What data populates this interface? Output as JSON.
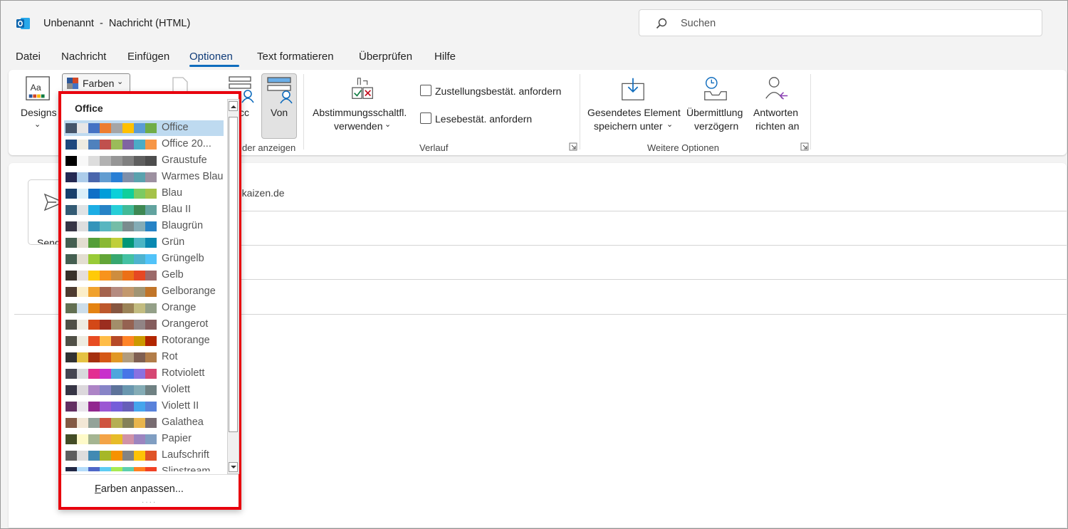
{
  "window": {
    "title": "Unbenannt  -  Nachricht (HTML)",
    "app_icon": "outlook-icon"
  },
  "search": {
    "placeholder": "Suchen"
  },
  "menu": {
    "tabs": [
      "Datei",
      "Nachricht",
      "Einfügen",
      "Optionen",
      "Text formatieren",
      "Überprüfen",
      "Hilfe"
    ],
    "active": "Optionen"
  },
  "ribbon": {
    "designs": "Designs",
    "farben": "Farben",
    "cc": "cc",
    "von": "Von",
    "felder_anzeigen": "der anzeigen",
    "abstimmung_line1": "Abstimmungsschaltfl.",
    "abstimmung_line2": "verwenden",
    "zustellung": "Zustellungsbestät. anfordern",
    "lesebest": "Lesebestät. anfordern",
    "verlauf": "Verlauf",
    "gesendet_line1": "Gesendetes Element",
    "gesendet_line2": "speichern unter",
    "uebermittlung_line1": "Übermittlung",
    "uebermittlung_line2": "verzögern",
    "antworten_line1": "Antworten",
    "antworten_line2": "richten an",
    "weitere": "Weitere Optionen"
  },
  "mail": {
    "send": "Send",
    "from_partial": "-kaizen.de"
  },
  "dropdown": {
    "header": "Office",
    "footer_prefix": "F",
    "footer_rest": "arben anpassen...",
    "selected": "Office",
    "schemes": [
      {
        "name": "Office",
        "colors": [
          "#44546a",
          "#e7e6e6",
          "#4472c4",
          "#ed7d31",
          "#a5a5a5",
          "#ffc000",
          "#5b9bd5",
          "#70ad47"
        ]
      },
      {
        "name": "Office 20...",
        "colors": [
          "#1f497d",
          "#eeece1",
          "#4f81bd",
          "#c0504d",
          "#9bbb59",
          "#8064a2",
          "#4bacc6",
          "#f79646"
        ]
      },
      {
        "name": "Graustufe",
        "colors": [
          "#000000",
          "#f8f8f8",
          "#dddddd",
          "#b2b2b2",
          "#969696",
          "#808080",
          "#5f5f5f",
          "#4d4d4d"
        ]
      },
      {
        "name": "Warmes Blau",
        "colors": [
          "#242852",
          "#acccea",
          "#4a66ac",
          "#629dd1",
          "#297fd5",
          "#7f8fa9",
          "#5aa2ae",
          "#9d90a0"
        ]
      },
      {
        "name": "Blau",
        "colors": [
          "#17406d",
          "#dbeff9",
          "#0f6fc6",
          "#009dd9",
          "#0bd0d9",
          "#10cf9b",
          "#7cca62",
          "#a5c249"
        ]
      },
      {
        "name": "Blau II",
        "colors": [
          "#335b74",
          "#dfe3e5",
          "#1cade4",
          "#2683c6",
          "#27ced7",
          "#42ba97",
          "#3e8853",
          "#62a39f"
        ]
      },
      {
        "name": "Blaugrün",
        "colors": [
          "#373545",
          "#dedede",
          "#3494ba",
          "#58b6c0",
          "#75bda7",
          "#7a8c8e",
          "#84acb6",
          "#2683c6"
        ]
      },
      {
        "name": "Grün",
        "colors": [
          "#455f51",
          "#e3ded1",
          "#549e39",
          "#8ab833",
          "#c0cf3a",
          "#029676",
          "#4ab5c4",
          "#0989b1"
        ]
      },
      {
        "name": "Grüngelb",
        "colors": [
          "#455f51",
          "#e3ded1",
          "#99cb38",
          "#63a537",
          "#37a76f",
          "#44c1a3",
          "#4eb3cf",
          "#51c3f9"
        ]
      },
      {
        "name": "Gelb",
        "colors": [
          "#39302a",
          "#e5dedb",
          "#ffca08",
          "#f8931d",
          "#ce8d3e",
          "#ec7016",
          "#e64823",
          "#9c6a6a"
        ]
      },
      {
        "name": "Gelborange",
        "colors": [
          "#4e3b30",
          "#fbeec9",
          "#f0a22e",
          "#a5644e",
          "#b58b80",
          "#c3986d",
          "#a19574",
          "#c17529"
        ]
      },
      {
        "name": "Orange",
        "colors": [
          "#637052",
          "#ccddea",
          "#e48312",
          "#bd582c",
          "#865640",
          "#9b8357",
          "#c2bc80",
          "#94a088"
        ]
      },
      {
        "name": "Orangerot",
        "colors": [
          "#505046",
          "#eeece1",
          "#d34817",
          "#9b2d1f",
          "#a28e6a",
          "#956251",
          "#918485",
          "#855d5d"
        ]
      },
      {
        "name": "Rotorange",
        "colors": [
          "#505046",
          "#eeece1",
          "#e84c22",
          "#ffbd47",
          "#b64926",
          "#ff8427",
          "#cc9900",
          "#b22600"
        ]
      },
      {
        "name": "Rot",
        "colors": [
          "#323232",
          "#e5c243",
          "#a5300f",
          "#d55816",
          "#e19825",
          "#b19c7d",
          "#7f5f52",
          "#b27d49"
        ]
      },
      {
        "name": "Rotviolett",
        "colors": [
          "#454551",
          "#d8d9dc",
          "#e32d91",
          "#c830cc",
          "#4ea6dc",
          "#4775e7",
          "#8971e1",
          "#d54773"
        ]
      },
      {
        "name": "Violett",
        "colors": [
          "#373545",
          "#dcd8dc",
          "#ad84c6",
          "#8784c7",
          "#5d739a",
          "#6997af",
          "#84acb6",
          "#6f8183"
        ]
      },
      {
        "name": "Violett II",
        "colors": [
          "#632e62",
          "#eae5eb",
          "#92278f",
          "#9b57d3",
          "#755dd9",
          "#665eb8",
          "#45a5ed",
          "#5982db"
        ]
      },
      {
        "name": "Galathea",
        "colors": [
          "#845a44",
          "#f2e7d6",
          "#93a299",
          "#cf543f",
          "#b5ae53",
          "#848058",
          "#e8b54d",
          "#786c71"
        ]
      },
      {
        "name": "Papier",
        "colors": [
          "#444d26",
          "#fefac9",
          "#a5b592",
          "#f3a447",
          "#e7bc29",
          "#d092a7",
          "#9c85c0",
          "#809ec2"
        ]
      },
      {
        "name": "Laufschrift",
        "colors": [
          "#5e5e5e",
          "#dddddd",
          "#418ab3",
          "#a6b727",
          "#f69200",
          "#838383",
          "#fec306",
          "#df5327"
        ]
      },
      {
        "name": "Slipstream",
        "colors": [
          "#212745",
          "#b4dcfa",
          "#4e67c8",
          "#5eccf3",
          "#a7ea52",
          "#5dceaf",
          "#ff8021",
          "#f14124"
        ]
      }
    ]
  }
}
